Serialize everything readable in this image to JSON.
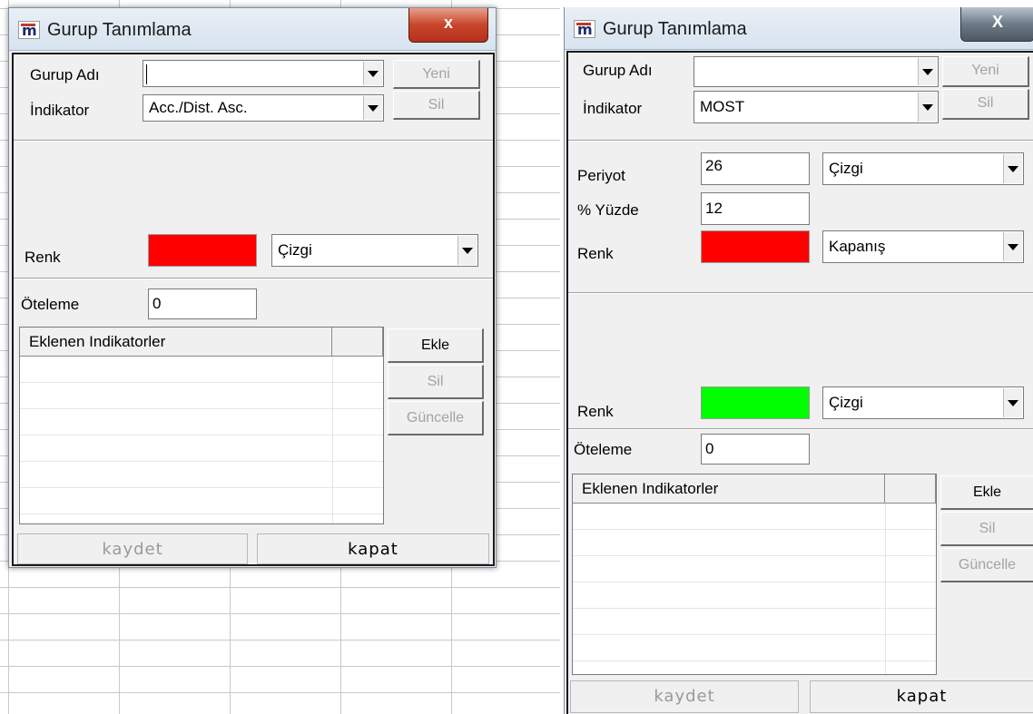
{
  "left_window": {
    "title": "Gurup Tanımlama",
    "close_label": "x",
    "group_name_label": "Gurup Adı",
    "group_name_value": "",
    "indicator_label": "İndikator",
    "indicator_value": "Acc./Dist. Asc.",
    "new_button": "Yeni",
    "delete_top_button": "Sil",
    "color_label": "Renk",
    "color_value": "#ff0000",
    "line_style_value": "Çizgi",
    "offset_label": "Öteleme",
    "offset_value": "0",
    "list_header": "Eklenen Indikatorler",
    "add_button": "Ekle",
    "delete_button": "Sil",
    "update_button": "Güncelle",
    "save_button": "kaydet",
    "close_button": "kapat"
  },
  "right_window": {
    "title": "Gurup Tanımlama",
    "close_label": "X",
    "group_name_label": "Gurup Adı",
    "group_name_value": "",
    "indicator_label": "İndikator",
    "indicator_value": "MOST",
    "new_button": "Yeni",
    "delete_top_button": "Sil",
    "period_label": "Periyot",
    "period_value": "26",
    "period_style_value": "Çizgi",
    "percent_label": "% Yüzde",
    "percent_value": "12",
    "color1_label": "Renk",
    "color1_value": "#ff0000",
    "price_source_value": "Kapanış",
    "color2_label": "Renk",
    "color2_value": "#00ff00",
    "line_style_value": "Çizgi",
    "offset_label": "Öteleme",
    "offset_value": "0",
    "list_header": "Eklenen Indikatorler",
    "add_button": "Ekle",
    "delete_button": "Sil",
    "update_button": "Güncelle",
    "save_button": "kaydet",
    "close_button": "kapat"
  }
}
